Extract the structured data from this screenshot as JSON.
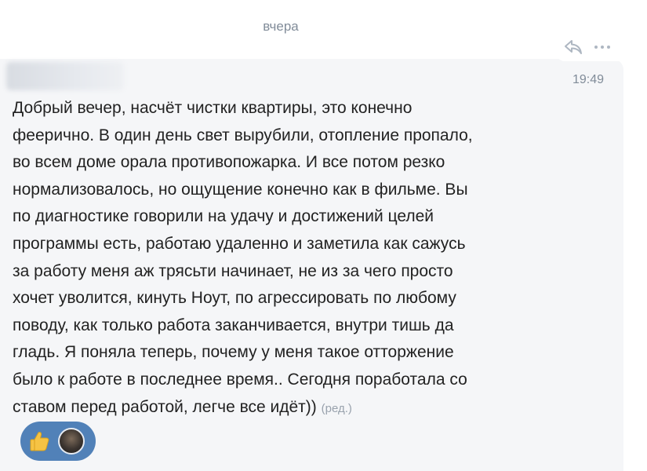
{
  "date_divider": "вчера",
  "message": {
    "time": "19:49",
    "lines": [
      "Добрый вечер, насчёт чистки квартиры, это конечно",
      "феерично. В один день свет вырубили, отопление пропало,",
      "во всем доме орала противопожарка. И все потом резко",
      "нормализовалось, но ощущение конечно как в фильме. Вы",
      "по диагностике говорили на удачу и достижений целей",
      "программы есть, работаю удаленно и заметила как сажусь",
      "за работу меня аж трясьти начинает, не из за чего просто",
      "хочет уволится, кинуть  Ноут, по агрессировать по любому",
      "поводу, как только работа заканчивается, внутри тишь да",
      "гладь. Я поняла теперь, почему у меня такое отторжение",
      "было к работе в последнее время.. Сегодня поработала со",
      "ставом перед работой, легче все идёт))"
    ],
    "edited_label": "(ред.)"
  },
  "actions": [
    {
      "icon": "reply-icon"
    },
    {
      "icon": "more-icon"
    }
  ],
  "reactions": [
    {
      "icon": "thumbs-up-icon"
    },
    {
      "icon": "reactor-avatar"
    }
  ],
  "colors": {
    "bubble": "#f5f6f8",
    "meta": "#818c99",
    "text": "#222222",
    "reaction_bg": "#5181b8"
  }
}
